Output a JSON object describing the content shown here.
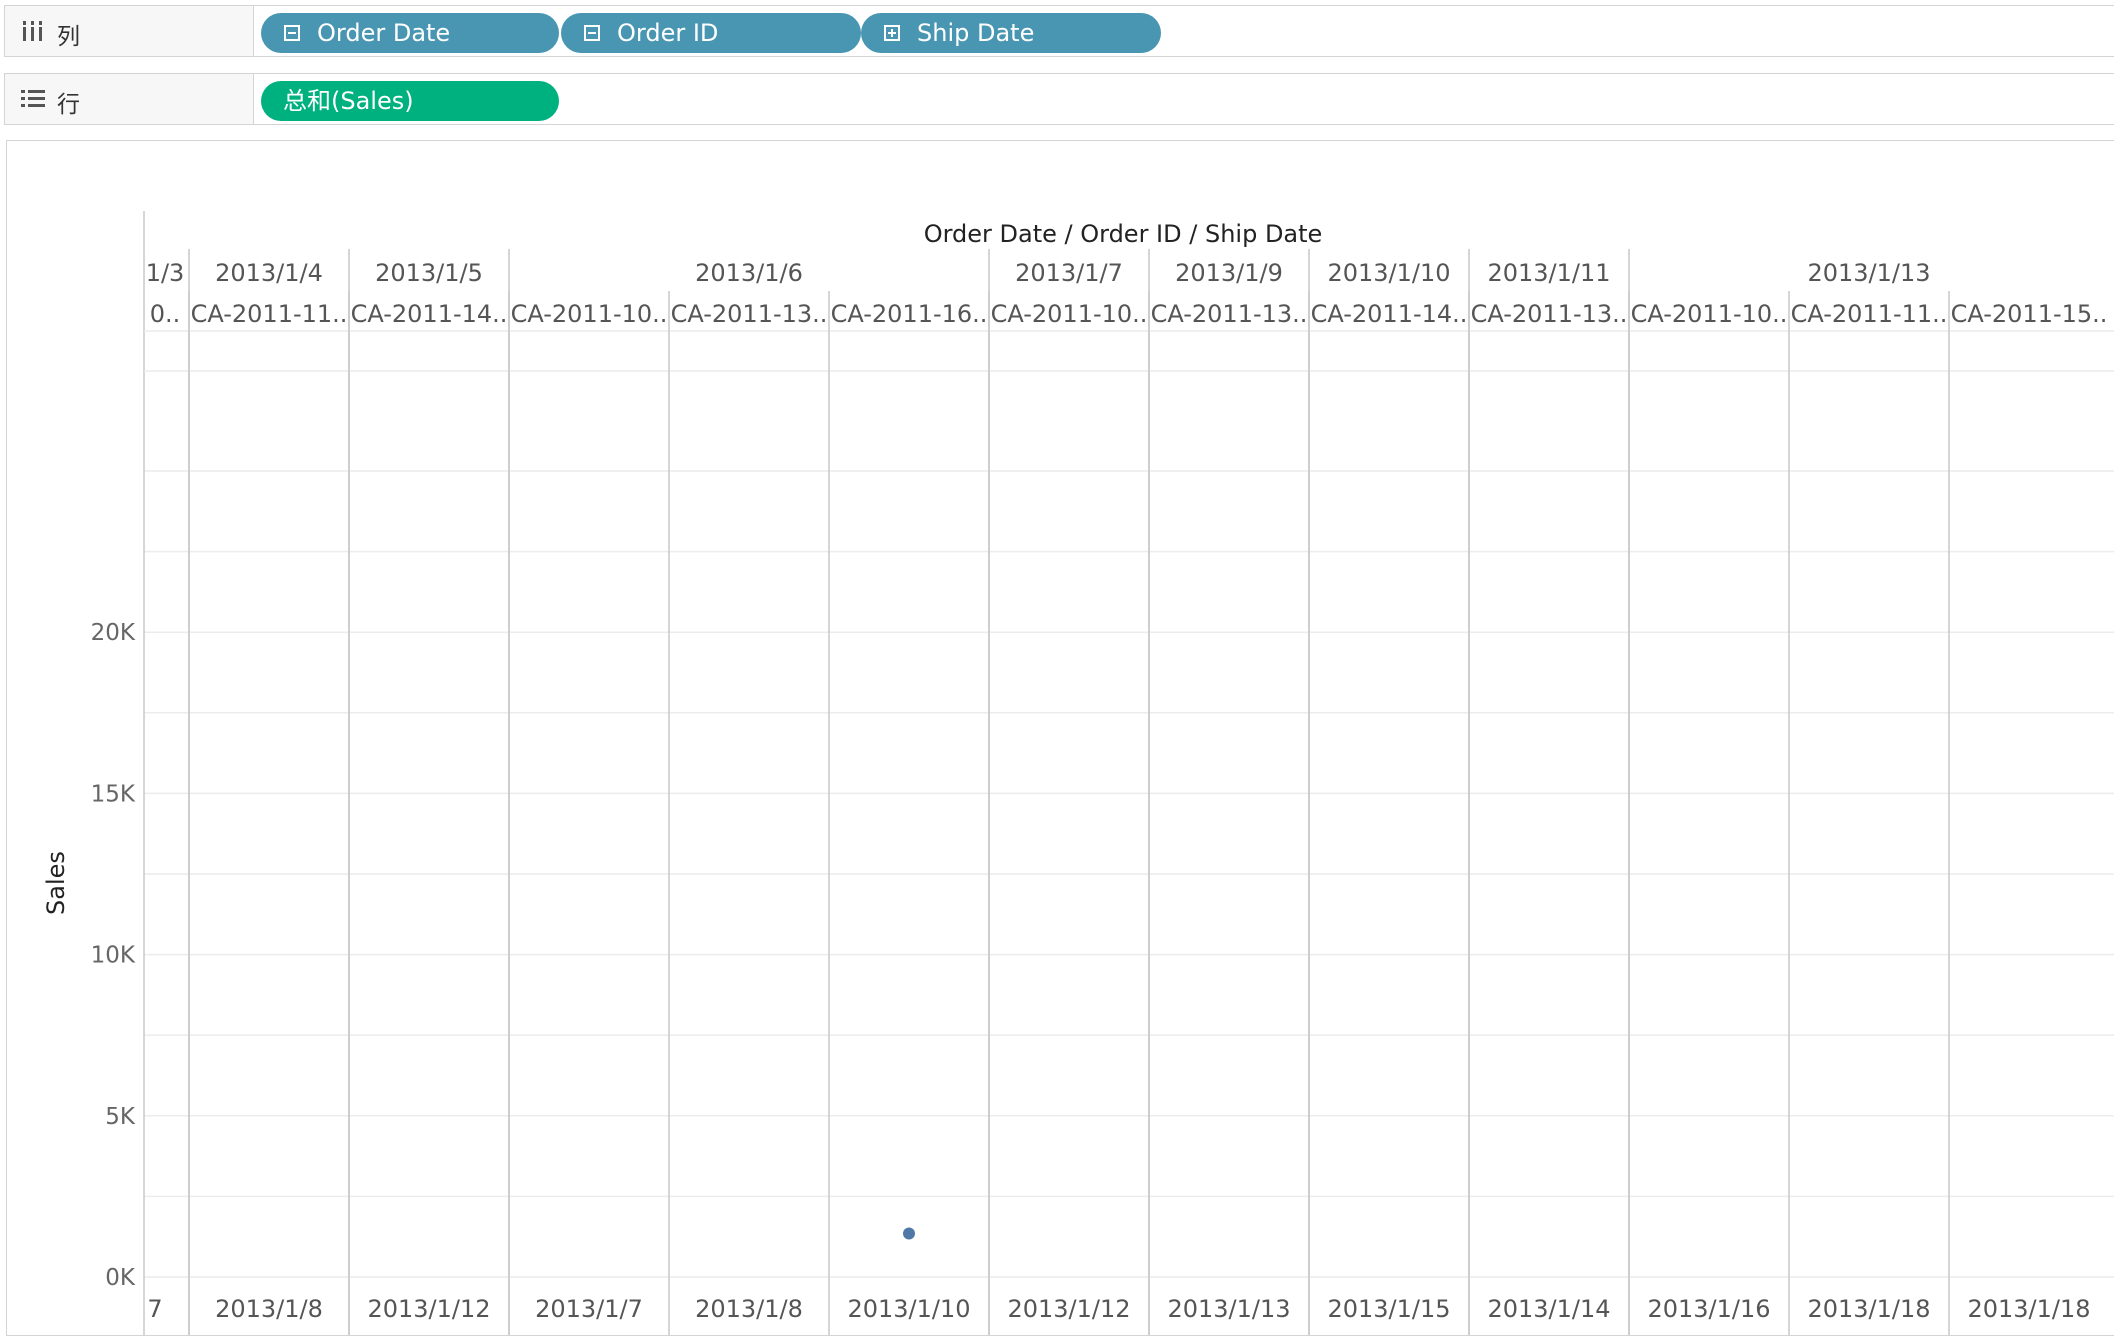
{
  "shelves": {
    "columns": {
      "label": "列",
      "pills": [
        {
          "label": "Order Date",
          "icon": "collapse-icon"
        },
        {
          "label": "Order ID",
          "icon": "collapse-icon"
        },
        {
          "label": "Ship Date",
          "icon": "expand-icon"
        }
      ]
    },
    "rows": {
      "label": "行",
      "pills": [
        {
          "label": "总和(Sales)"
        }
      ]
    }
  },
  "colors": {
    "dimension_pill": "#4996b2",
    "measure_pill": "#00b180",
    "mark": "#4e79a7",
    "gridline": "#ececec",
    "divider": "#c8c8c8"
  },
  "chart_data": {
    "type": "scatter",
    "title": "Order Date / Order ID / Ship Date",
    "ylabel": "Sales",
    "ylim": [
      -1800,
      25000
    ],
    "yticks": [
      0,
      5000,
      10000,
      15000,
      20000
    ],
    "ytick_labels": [
      "0K",
      "5K",
      "10K",
      "15K",
      "20K"
    ],
    "grid": true,
    "order_dates": [
      {
        "label": "1/3",
        "span": 1
      },
      {
        "label": "2013/1/4",
        "span": 1
      },
      {
        "label": "2013/1/5",
        "span": 1
      },
      {
        "label": "2013/1/6",
        "span": 3
      },
      {
        "label": "2013/1/7",
        "span": 1
      },
      {
        "label": "2013/1/9",
        "span": 1
      },
      {
        "label": "2013/1/10",
        "span": 1
      },
      {
        "label": "2013/1/11",
        "span": 1
      },
      {
        "label": "2013/1/13",
        "span": 3
      }
    ],
    "columns": [
      {
        "order_id": "0..",
        "ship_date": "7",
        "sales": null
      },
      {
        "order_id": "CA-2011-11..",
        "ship_date": "2013/1/8",
        "sales": null
      },
      {
        "order_id": "CA-2011-14..",
        "ship_date": "2013/1/12",
        "sales": null
      },
      {
        "order_id": "CA-2011-10..",
        "ship_date": "2013/1/7",
        "sales": null
      },
      {
        "order_id": "CA-2011-13..",
        "ship_date": "2013/1/8",
        "sales": null
      },
      {
        "order_id": "CA-2011-16..",
        "ship_date": "2013/1/10",
        "sales": 1350
      },
      {
        "order_id": "CA-2011-10..",
        "ship_date": "2013/1/12",
        "sales": null
      },
      {
        "order_id": "CA-2011-13..",
        "ship_date": "2013/1/13",
        "sales": null
      },
      {
        "order_id": "CA-2011-14..",
        "ship_date": "2013/1/15",
        "sales": null
      },
      {
        "order_id": "CA-2011-13..",
        "ship_date": "2013/1/14",
        "sales": null
      },
      {
        "order_id": "CA-2011-10..",
        "ship_date": "2013/1/16",
        "sales": null
      },
      {
        "order_id": "CA-2011-11..",
        "ship_date": "2013/1/18",
        "sales": null
      },
      {
        "order_id": "CA-2011-15..",
        "ship_date": "2013/1/18",
        "sales": null
      }
    ]
  }
}
